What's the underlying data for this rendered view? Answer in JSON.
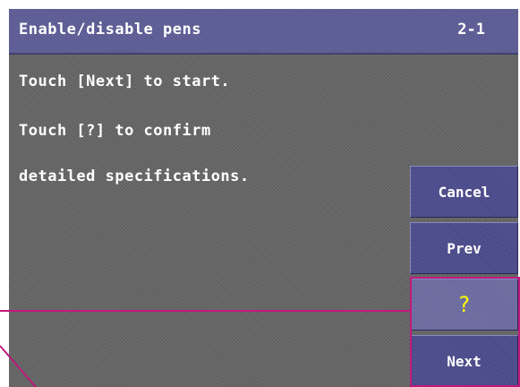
{
  "screen": {
    "title": "Enable/disable pens",
    "page_number": "2-1"
  },
  "messages": [
    "Touch [Next] to start.",
    "Touch [?] to confirm",
    "detailed specifications."
  ],
  "buttons": {
    "cancel": "Cancel",
    "prev": "Prev",
    "help": "?",
    "next": "Next"
  },
  "colors": {
    "background": "#666666",
    "title_bar": "#5c5c94",
    "button": "#4a4a8a",
    "help_button": "#6a6a9e",
    "help_glyph": "#ffff00",
    "callout": "#c0197c"
  }
}
